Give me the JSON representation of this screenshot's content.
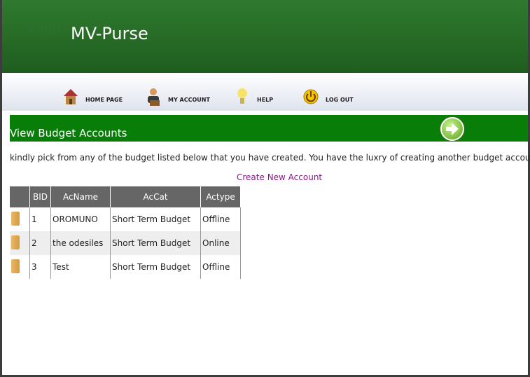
{
  "app": {
    "logo_text": "eMpre",
    "logo_tagline": "",
    "title": "MV-Purse"
  },
  "nav": {
    "items": [
      {
        "label": "HOME PAGE",
        "icon": "home-icon"
      },
      {
        "label": "MY ACCOUNT",
        "icon": "account-icon"
      },
      {
        "label": "HELP",
        "icon": "help-icon"
      },
      {
        "label": "LOG OUT",
        "icon": "logout-icon"
      }
    ]
  },
  "section": {
    "title": "View Budget Accounts",
    "intro": "kindly pick from any of the budget listed below that you have created. You have the luxry of creating another budget account.",
    "create_link": "Create New Account"
  },
  "table": {
    "headers": [
      "",
      "BID",
      "AcName",
      "AcCat",
      "Actype"
    ],
    "rows": [
      {
        "bid": "1",
        "name": "OROMUNO",
        "cat": "Short Term Budget",
        "type": "Offline"
      },
      {
        "bid": "2",
        "name": "the odesiles",
        "cat": "Short Term Budget",
        "type": "Online"
      },
      {
        "bid": "3",
        "name": "Test",
        "cat": "Short Term Budget",
        "type": "Offline"
      }
    ]
  },
  "colors": {
    "header_green": "#1f6b1f",
    "band_green": "#087e08",
    "link_purple": "#8a1a8a",
    "table_header": "#666666"
  }
}
